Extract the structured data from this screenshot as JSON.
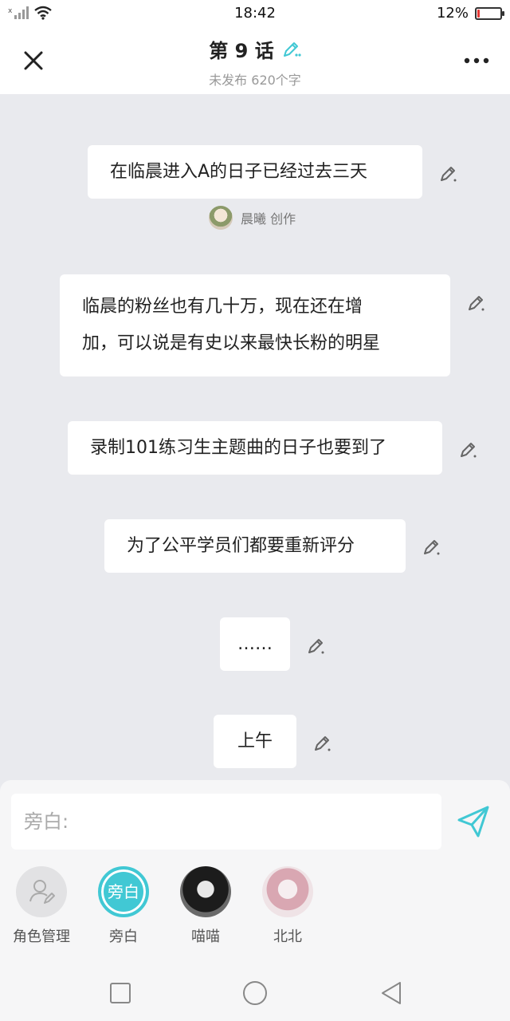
{
  "status_bar": {
    "time": "18:42",
    "battery": "12%",
    "battery_level": 0.12
  },
  "header": {
    "title": "第 9 话",
    "subtitle": "未发布 620个字"
  },
  "messages": [
    {
      "text": "在临晨进入A的日子已经过去三天"
    },
    {
      "text_line1": "临晨的粉丝也有几十万，现在还在增",
      "text_line2": "加，可以说是有史以来最快长粉的明星"
    },
    {
      "text": "录制101练习生主题曲的日子也要到了"
    },
    {
      "text": "为了公平学员们都要重新评分"
    },
    {
      "text": "……"
    },
    {
      "text": "上午"
    }
  ],
  "author": {
    "name": "晨曦 创作"
  },
  "input": {
    "placeholder": "旁白:"
  },
  "roles": [
    {
      "label": "角色管理"
    },
    {
      "label": "旁白",
      "badge": "旁白"
    },
    {
      "label": "喵喵"
    },
    {
      "label": "北北"
    }
  ],
  "colors": {
    "accent": "#41c8d4",
    "battery_low": "#e53935"
  }
}
